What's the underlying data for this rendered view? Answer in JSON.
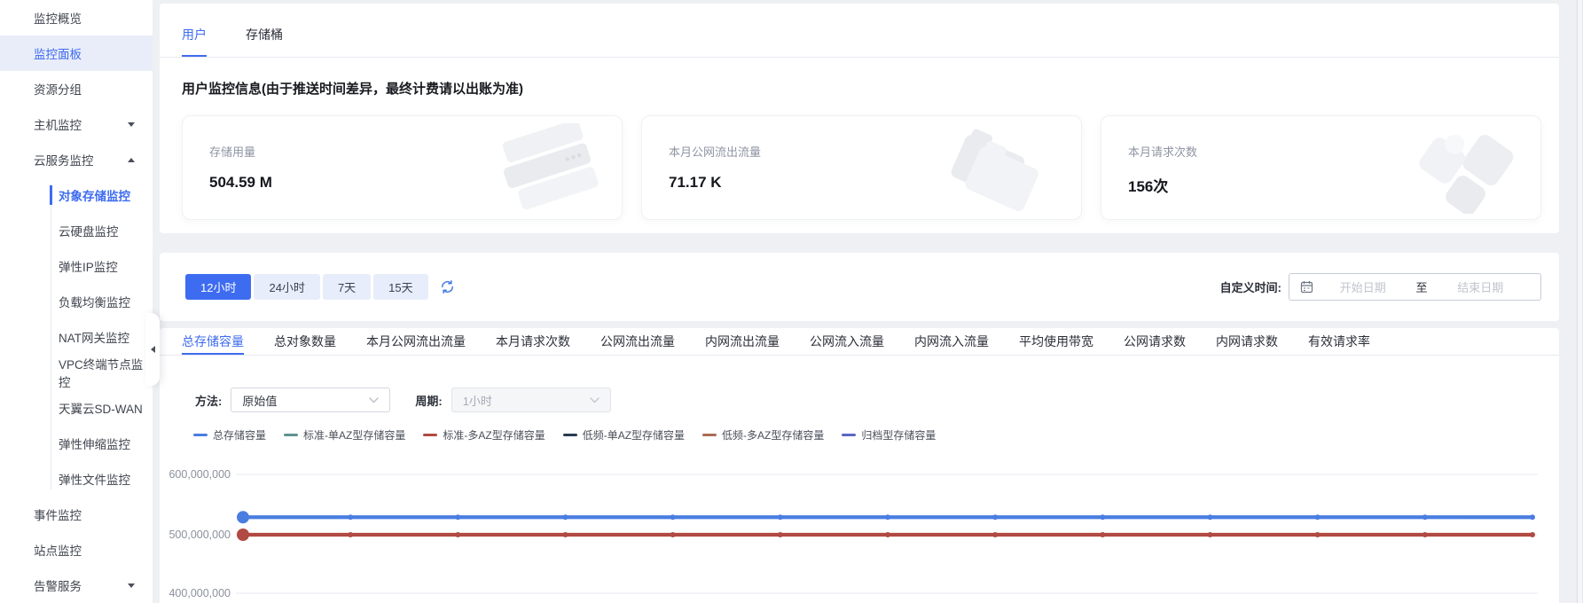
{
  "sidebar": {
    "top_items": [
      "监控概览",
      "监控面板",
      "资源分组",
      "主机监控",
      "云服务监控"
    ],
    "sub_items": [
      "对象存储监控",
      "云硬盘监控",
      "弹性IP监控",
      "负载均衡监控",
      "NAT网关监控",
      "VPC终端节点监控",
      "天翼云SD-WAN",
      "弹性伸缩监控",
      "弹性文件监控"
    ],
    "bottom_items": [
      "事件监控",
      "站点监控",
      "告警服务"
    ]
  },
  "main": {
    "tabs": [
      {
        "label": "用户",
        "active": true
      },
      {
        "label": "存储桶",
        "active": false
      }
    ],
    "notice": "用户监控信息(由于推送时间差异，最终计费请以出账为准)",
    "cards": [
      {
        "label": "存储用量",
        "value": "504.59 M",
        "icon": "server-stack-illustration"
      },
      {
        "label": "本月公网流出流量",
        "value": "71.17 K",
        "icon": "folder-illustration"
      },
      {
        "label": "本月请求次数",
        "value": "156次",
        "icon": "blocks-illustration"
      }
    ]
  },
  "controls": {
    "ranges": [
      {
        "label": "12小时",
        "active": true
      },
      {
        "label": "24小时",
        "active": false
      },
      {
        "label": "7天",
        "active": false
      },
      {
        "label": "15天",
        "active": false
      }
    ],
    "custom_time_label": "自定义时间:",
    "start_placeholder": "开始日期",
    "separator": "至",
    "end_placeholder": "结束日期",
    "method_label": "方法:",
    "method_value": "原始值",
    "period_label": "周期:",
    "period_value": "1小时"
  },
  "metric_tabs": [
    "总存储容量",
    "总对象数量",
    "本月公网流出流量",
    "本月请求次数",
    "公网流出流量",
    "内网流出流量",
    "公网流入流量",
    "内网流入流量",
    "平均使用带宽",
    "公网请求数",
    "内网请求数",
    "有效请求率"
  ],
  "icons": {
    "refresh": "refresh-icon",
    "calendar": "calendar-icon",
    "collapse": "collapse-left-icon",
    "chevron": "chevron-down-icon"
  },
  "colors": {
    "primary": "#3e6cf1",
    "line_blue": "#4a7de0",
    "line_red": "#b04a42",
    "grid": "#e7e9ef",
    "axis_text": "#8b909c"
  },
  "chart_data": {
    "type": "line",
    "title": "总存储容量",
    "x_points": 13,
    "xlabel": "",
    "ylabel": "",
    "grid": "horizontal",
    "legend_position": "top-left",
    "yticks": [
      600000000,
      500000000,
      400000000
    ],
    "ytick_labels": [
      "600,000,000",
      "500,000,000",
      "400,000,000"
    ],
    "series": [
      {
        "name": "总存储容量",
        "color": "#4a7de0",
        "values": [
          529000000,
          529000000,
          529000000,
          529000000,
          529000000,
          529000000,
          529000000,
          529000000,
          529000000,
          529000000,
          529000000,
          529000000,
          529000000
        ]
      },
      {
        "name": "标准-单AZ型存储容量",
        "color": "#5f9390",
        "values": null
      },
      {
        "name": "标准-多AZ型存储容量",
        "color": "#b04a42",
        "values": [
          500000000,
          500000000,
          500000000,
          500000000,
          500000000,
          500000000,
          500000000,
          500000000,
          500000000,
          500000000,
          500000000,
          500000000,
          500000000
        ]
      },
      {
        "name": "低频-单AZ型存储容量",
        "color": "#2b3b52",
        "values": null
      },
      {
        "name": "低频-多AZ型存储容量",
        "color": "#ad6a55",
        "values": null
      },
      {
        "name": "归档型存储容量",
        "color": "#5a67c2",
        "values": null
      }
    ]
  }
}
